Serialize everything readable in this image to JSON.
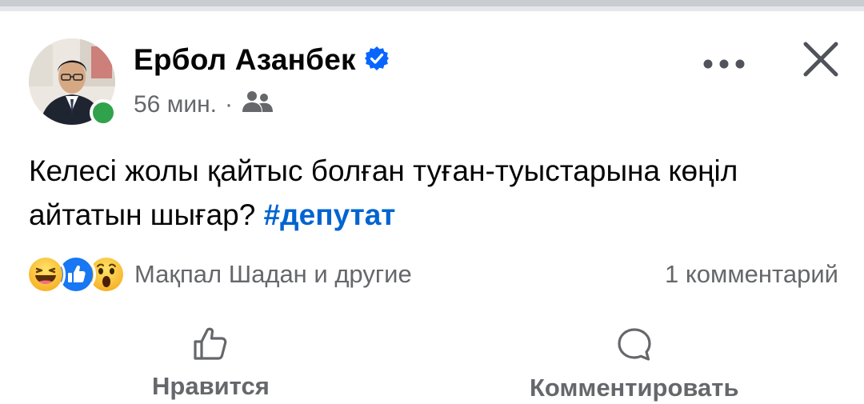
{
  "post": {
    "author": "Ербол Азанбек",
    "time": "56 мин.",
    "separator": "·",
    "audience_icon": "friends-icon",
    "text": "Келесі жолы қайтыс болған туған-туыстарына көңіл айтатын шығар? ",
    "hashtag": "#депутат",
    "reactions": {
      "icons": [
        "haha-reaction-icon",
        "like-reaction-icon",
        "wow-reaction-icon"
      ],
      "summary": "Мақпал Шадан и другие",
      "comments": "1 комментарий"
    },
    "actions": {
      "like_label": "Нравится",
      "comment_label": "Комментировать"
    }
  },
  "colors": {
    "online": "#31a24c",
    "verified": "#0866ff",
    "hashtag": "#0064d1",
    "secondary_text": "#65676b"
  }
}
